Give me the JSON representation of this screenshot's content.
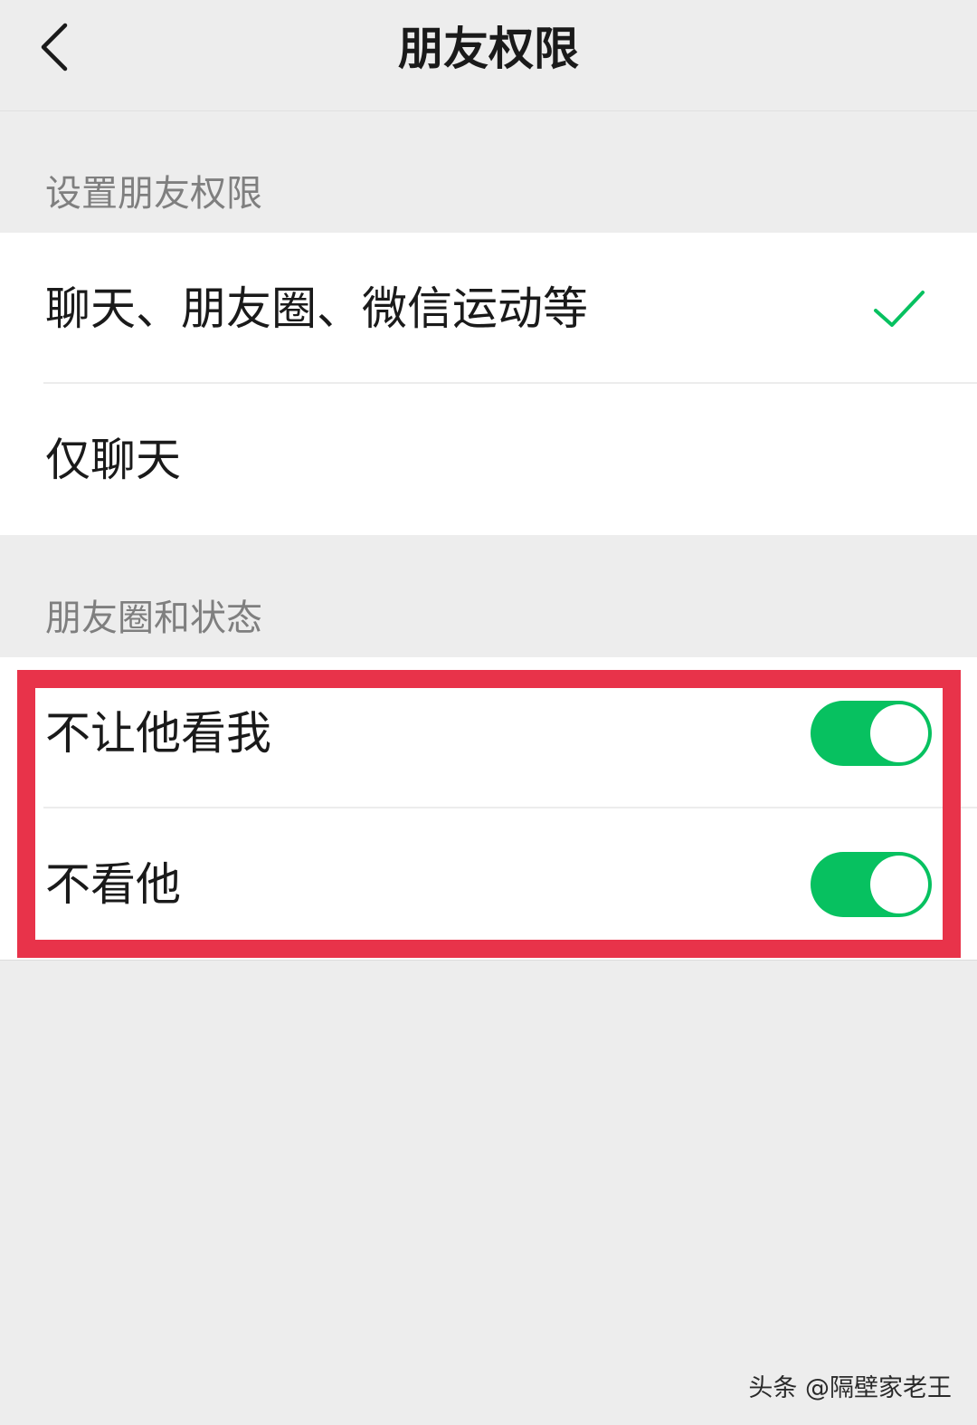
{
  "nav": {
    "title": "朋友权限"
  },
  "section_permissions": {
    "header": "设置朋友权限",
    "options": [
      {
        "label": "聊天、朋友圈、微信运动等",
        "selected": true
      },
      {
        "label": "仅聊天",
        "selected": false
      }
    ]
  },
  "section_moments": {
    "header": "朋友圈和状态",
    "toggles": [
      {
        "label": "不让他看我",
        "on": true
      },
      {
        "label": "不看他",
        "on": true
      }
    ]
  },
  "colors": {
    "accent": "#07c160",
    "highlight": "#e8334a"
  },
  "watermark": "头条 @隔壁家老王"
}
